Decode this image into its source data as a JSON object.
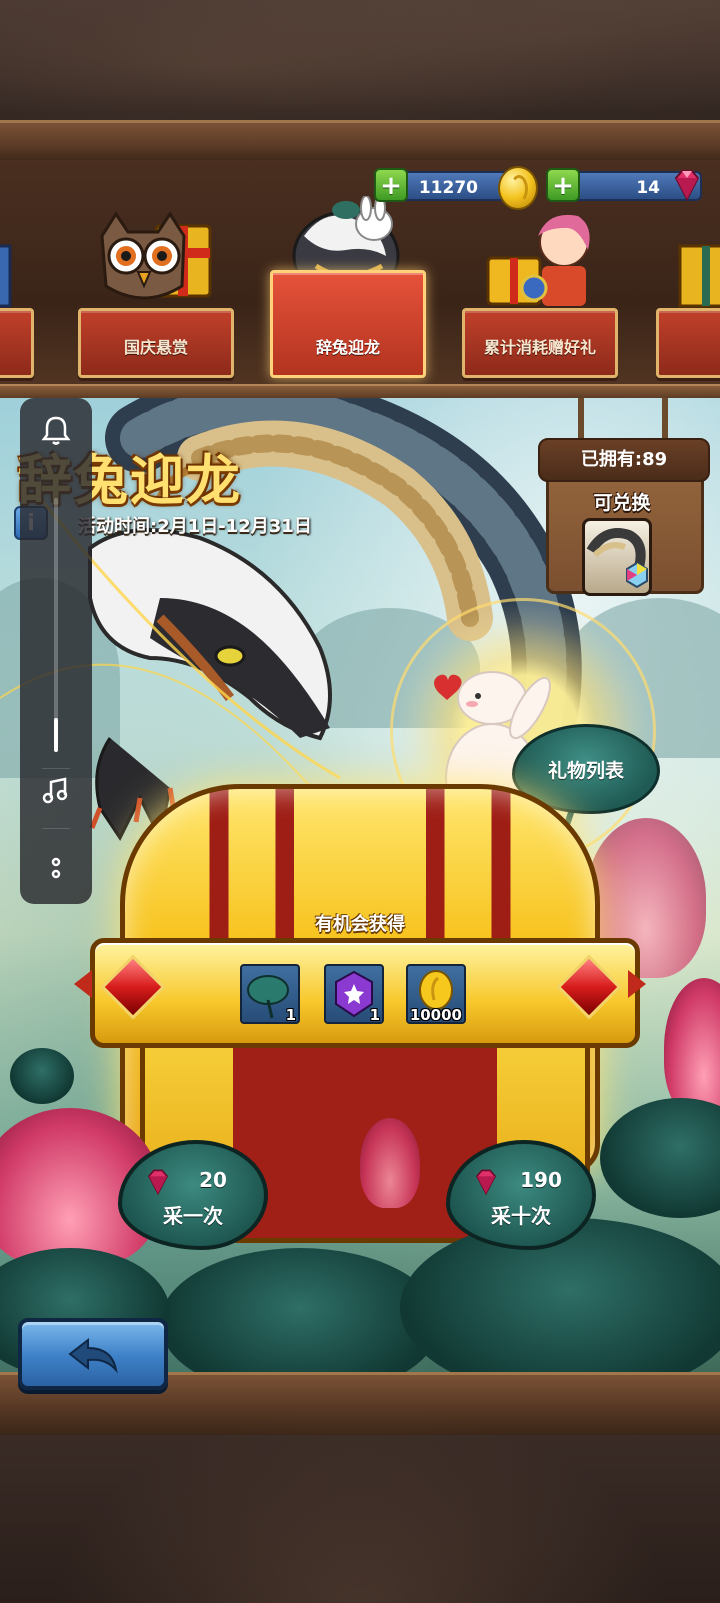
{
  "currency": {
    "coins": "11270",
    "gems": "14",
    "coin_icon": "gold-coin-icon",
    "gem_icon": "ruby-gem-icon",
    "add_icon": "plus-icon"
  },
  "tabs": [
    {
      "label": "国庆悬赏",
      "icon": "owl-gift-icon",
      "active": false
    },
    {
      "label": "辞兔迎龙",
      "icon": "dragon-rabbit-icon",
      "active": true
    },
    {
      "label": "累计消耗赠好礼",
      "icon": "gift-character-icon",
      "active": false
    }
  ],
  "event": {
    "title": "辞兔迎龙",
    "time": "活动时间:2月1日-12月31日",
    "info_icon": "info-icon"
  },
  "exchange": {
    "owned": "已拥有:89",
    "exchangeable": "可兑换"
  },
  "gift_list": {
    "label": "礼物列表"
  },
  "chance": {
    "title": "有机会获得",
    "rewards": [
      {
        "icon": "lotus-leaf-icon",
        "count": "1"
      },
      {
        "icon": "purple-crystal-icon",
        "count": "1"
      },
      {
        "icon": "gold-coin-icon",
        "count": "10000"
      }
    ]
  },
  "actions": {
    "single": {
      "cost": "20",
      "label": "采一次"
    },
    "ten": {
      "cost": "190",
      "label": "采十次"
    }
  },
  "overlay": {
    "bell_icon": "bell-icon",
    "music_icon": "music-note-icon",
    "more_icon": "more-dots-icon"
  },
  "colors": {
    "accent_gold": "#ffe070",
    "tab_red": "#c0402a",
    "leaf_green": "#1f5a54",
    "button_blue": "#3d7fc6"
  }
}
